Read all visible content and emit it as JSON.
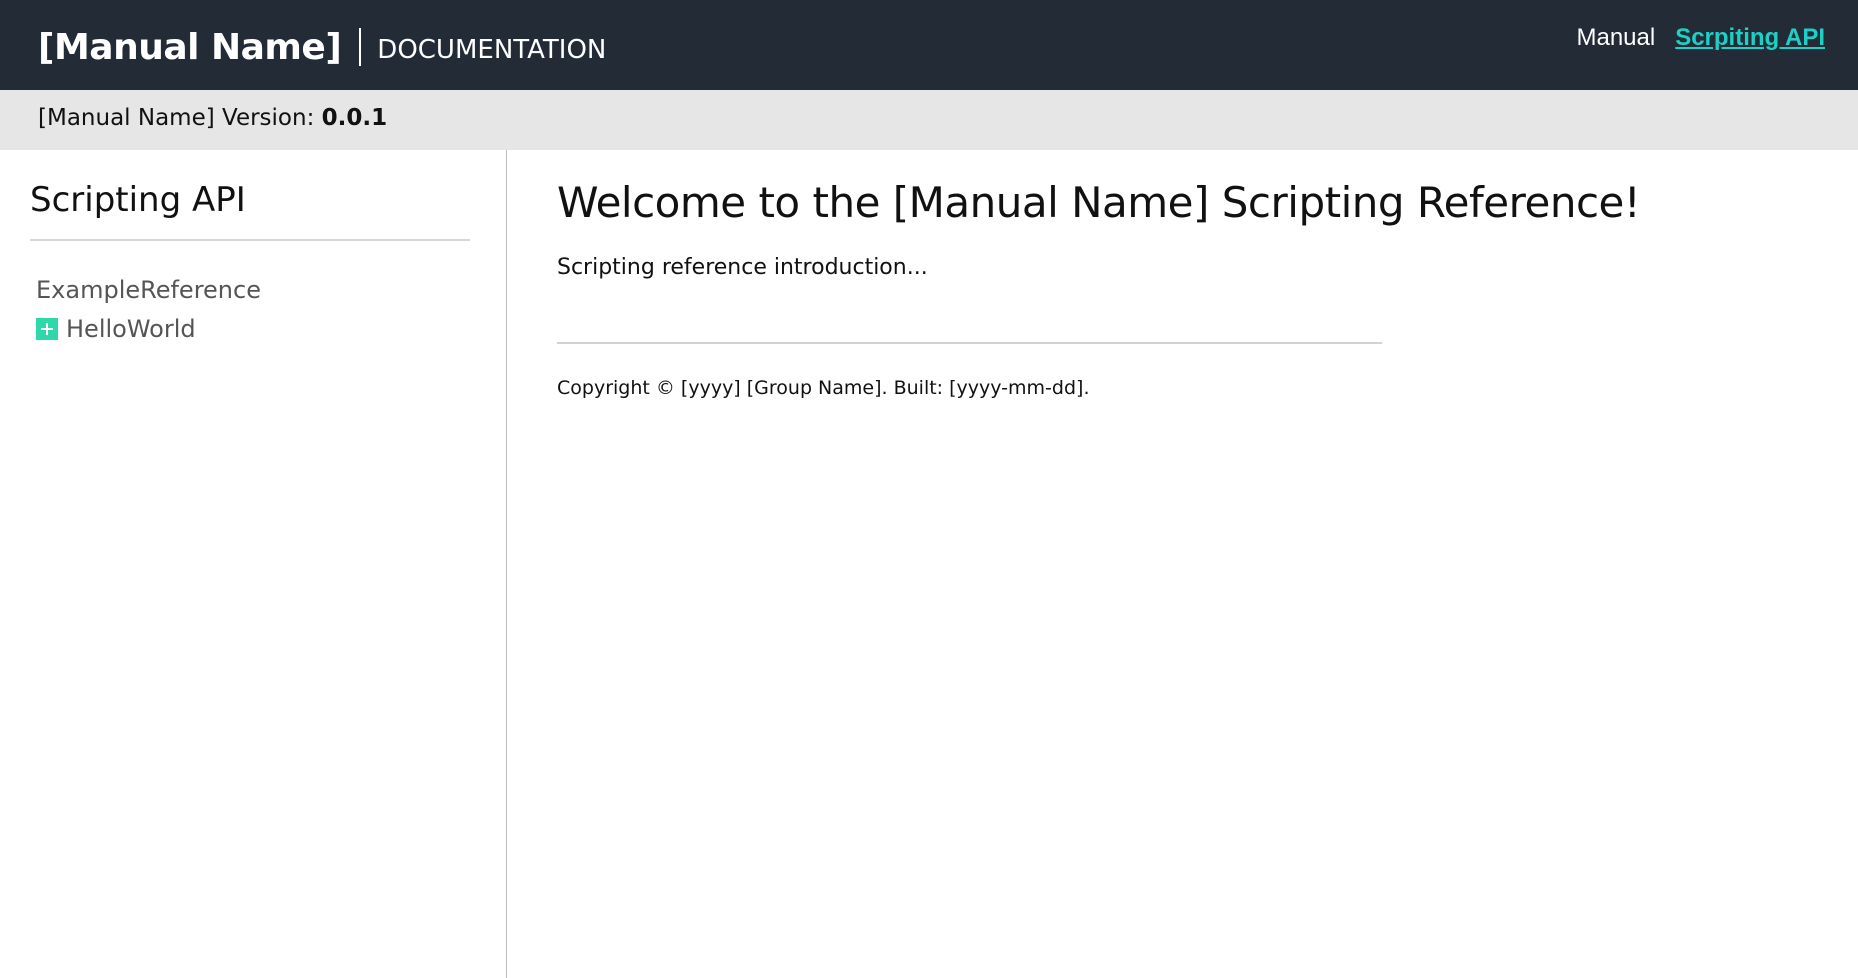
{
  "header": {
    "brand_name": "[Manual Name]",
    "brand_section": "DOCUMENTATION",
    "nav": [
      {
        "label": "Manual",
        "active": false
      },
      {
        "label": "Scrpiting API",
        "active": true
      }
    ]
  },
  "version_bar": {
    "prefix": "[Manual Name] Version: ",
    "version": "0.0.1"
  },
  "sidebar": {
    "title": "Scripting API",
    "items": [
      {
        "label": "ExampleReference",
        "expandable": false
      },
      {
        "label": "HelloWorld",
        "expandable": true,
        "icon": "plus-expand-icon"
      }
    ]
  },
  "main": {
    "title": "Welcome to the [Manual Name] Scripting Reference!",
    "intro": "Scripting reference introduction...",
    "footer": "Copyright © [yyyy] [Group Name]. Built: [yyyy-mm-dd]."
  },
  "colors": {
    "header_bg": "#222b36",
    "version_bar_bg": "#e6e6e6",
    "accent_link": "#1ecfc6",
    "expand_icon": "#2ed8a8"
  }
}
